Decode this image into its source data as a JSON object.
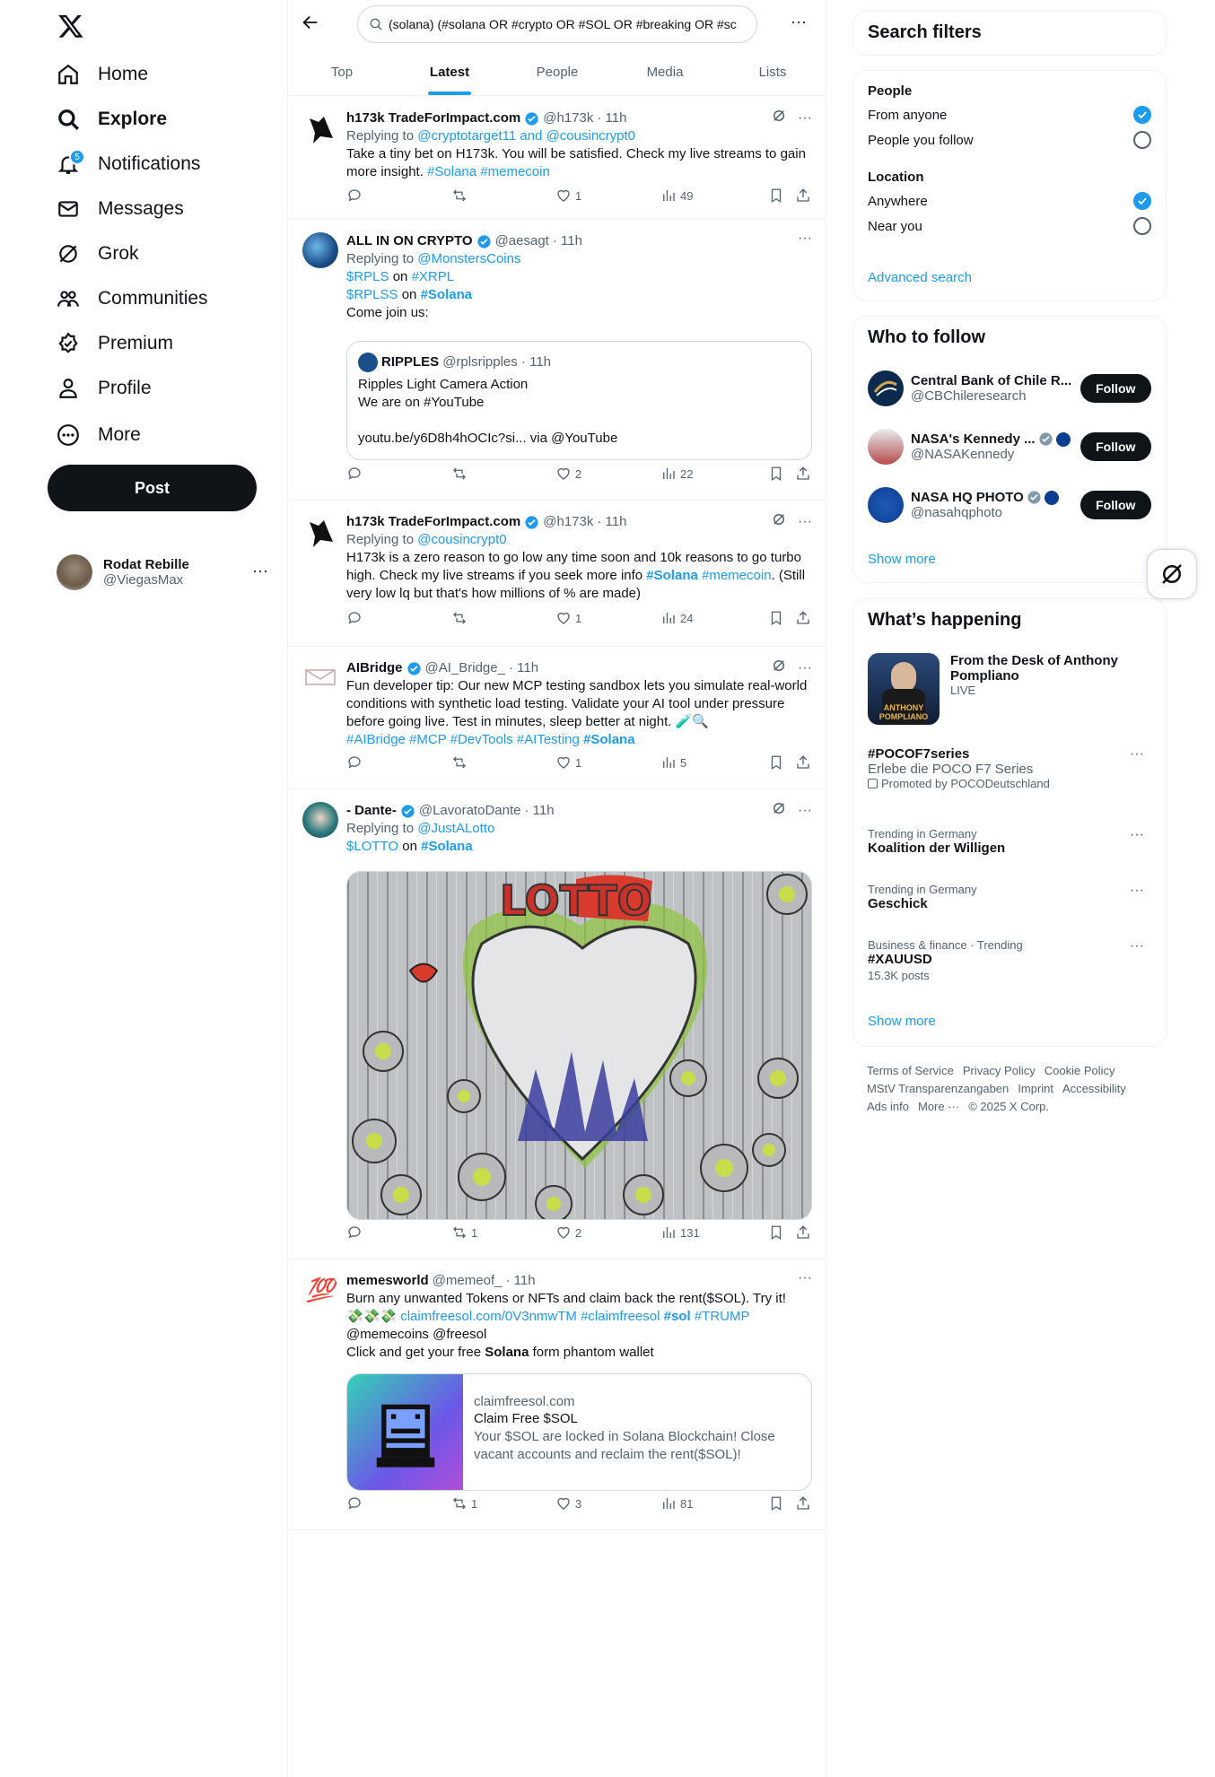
{
  "nav": {
    "items": [
      {
        "label": "Home",
        "icon": "home-icon"
      },
      {
        "label": "Explore",
        "icon": "search-icon"
      },
      {
        "label": "Notifications",
        "icon": "bell-icon",
        "badge": "5"
      },
      {
        "label": "Messages",
        "icon": "envelope-icon"
      },
      {
        "label": "Grok",
        "icon": "grok-icon"
      },
      {
        "label": "Communities",
        "icon": "communities-icon"
      },
      {
        "label": "Premium",
        "icon": "premium-icon"
      },
      {
        "label": "Profile",
        "icon": "person-icon"
      },
      {
        "label": "More",
        "icon": "more-circle-icon"
      }
    ],
    "post_label": "Post",
    "account": {
      "name": "Rodat Rebille",
      "handle": "@ViegasMax"
    }
  },
  "search": {
    "query": "(solana) (#solana OR #crypto OR #SOL OR #breaking OR #sc"
  },
  "tabs": [
    "Top",
    "Latest",
    "People",
    "Media",
    "Lists"
  ],
  "tweets": [
    {
      "name": "h173k TradeForImpact.com",
      "handle": "@h173k",
      "time": "· 11h",
      "reply_to_prefix": "Replying to ",
      "reply_to": "@cryptotarget11 and @cousincrypt0",
      "text": "Take a tiny bet on H173k. You will be satisfied. Check my live streams to gain more insight.",
      "tags": "#Solana #memecoin",
      "replies": "",
      "reposts": "",
      "likes": "1",
      "views": "49"
    },
    {
      "name": "ALL IN ON CRYPTO",
      "handle": "@aesagt",
      "time": "· 11h",
      "reply_to_prefix": "Replying to ",
      "reply_to": "@MonstersCoins",
      "line1_a": "$RPLS",
      "line1_b": " on ",
      "line1_c": "#XRPL",
      "line2_a": "$RPLSS",
      "line2_b": " on ",
      "line2_c": "#Solana",
      "line3": "Come join us:",
      "quote": {
        "name": "RIPPLES",
        "handle": "@rplsripples · 11h",
        "line1": "Ripples Light Camera Action",
        "line2": "We are on #YouTube",
        "line3": "youtu.be/y6D8h4hOCIc?si... via @YouTube"
      },
      "replies": "",
      "reposts": "",
      "likes": "2",
      "views": "22"
    },
    {
      "name": "h173k TradeForImpact.com",
      "handle": "@h173k",
      "time": "· 11h",
      "reply_to_prefix": "Replying to ",
      "reply_to": "@cousincrypt0",
      "text_a": "H173k is a zero reason to go low any time soon and 10k reasons to go turbo high. Check my live streams if you seek more info ",
      "text_b": "#Solana",
      "text_c": " #memecoin",
      "text_d": ". (Still very low lq but that's how millions of % are made)",
      "replies": "",
      "reposts": "",
      "likes": "1",
      "views": "24"
    },
    {
      "name": "AIBridge",
      "handle": "@AI_Bridge_",
      "time": "· 11h",
      "text": "Fun developer tip: Our new MCP testing sandbox lets you simulate real-world conditions with synthetic load testing. Validate your AI tool under pressure before going live. Test in minutes, sleep better at night. 🧪🔍",
      "tags_a": "#AIBridge #MCP #DevTools #AITesting ",
      "tags_b": "#Solana",
      "replies": "",
      "reposts": "",
      "likes": "1",
      "views": "5"
    },
    {
      "name": "- Dante-",
      "handle": "@LavoratoDante",
      "time": "· 11h",
      "reply_to_prefix": "Replying to ",
      "reply_to": "@JustALotto",
      "line_a": "$LOTTO",
      "line_b": " on ",
      "line_c": "#Solana",
      "image_text": "LOTTO",
      "replies": "",
      "reposts": "1",
      "likes": "2",
      "views": "131"
    },
    {
      "name": "memesworld",
      "handle": "@memeof_",
      "time": "· 11h",
      "line1": "Burn any unwanted Tokens or NFTs and claim back the rent($SOL). Try it!",
      "line2_emoji": "💸💸💸 ",
      "line2_link": "claimfreesol.com/0V3nmwTM #claimfreesol ",
      "line2_bold": "#sol",
      "line2_tail": " #TRUMP",
      "line3": "@memecoins @freesol",
      "line4_a": "Click and get your free ",
      "line4_b": "Solana",
      "line4_c": " form phantom wallet",
      "card": {
        "domain": "claimfreesol.com",
        "title": "Claim Free $SOL",
        "desc": "Your $SOL are locked in Solana Blockchain! Close vacant accounts and reclaim the rent($SOL)!"
      },
      "replies": "",
      "reposts": "1",
      "likes": "3",
      "views": "81"
    }
  ],
  "filters": {
    "title": "Search filters",
    "people_label": "People",
    "from_anyone": "From anyone",
    "people_you_follow": "People you follow",
    "location_label": "Location",
    "anywhere": "Anywhere",
    "near_you": "Near you",
    "advanced": "Advanced search"
  },
  "who_to_follow": {
    "title": "Who to follow",
    "accounts": [
      {
        "name": "Central Bank of Chile R...",
        "handle": "@CBChileresearch"
      },
      {
        "name": "NASA's Kennedy ...",
        "handle": "@NASAKennedy"
      },
      {
        "name": "NASA HQ PHOTO",
        "handle": "@nasahqphoto"
      }
    ],
    "follow_label": "Follow",
    "show_more": "Show more"
  },
  "happening": {
    "title": "What’s happening",
    "live": {
      "title": "From the Desk of Anthony Pompliano",
      "status": "LIVE",
      "thumb_text": "ANTHONY POMPLIANO"
    },
    "promoted": {
      "title": "#POCOF7series",
      "desc": "Erlebe die POCO F7 Series",
      "by": "Promoted by POCODeutschland"
    },
    "trends": [
      {
        "context": "Trending in Germany",
        "title": "Koalition der Willigen"
      },
      {
        "context": "Trending in Germany",
        "title": "Geschick"
      },
      {
        "context": "Business & finance · Trending",
        "title": "#XAUUSD",
        "posts": "15.3K posts"
      }
    ],
    "show_more": "Show more"
  },
  "footer": [
    "Terms of Service",
    "Privacy Policy",
    "Cookie Policy",
    "MStV Transparenzangaben",
    "Imprint",
    "Accessibility",
    "Ads info",
    "More ···",
    "© 2025 X Corp."
  ]
}
